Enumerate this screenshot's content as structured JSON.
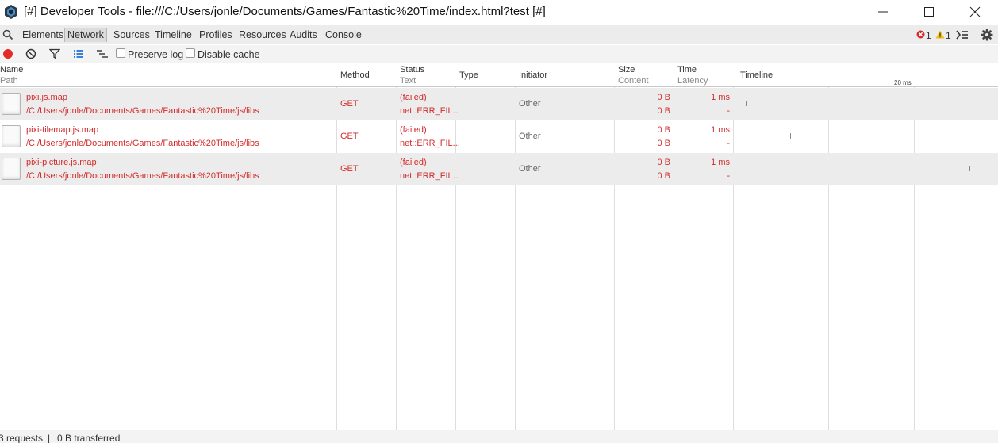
{
  "window": {
    "title": "[#] Developer Tools - file:///C:/Users/jonle/Documents/Games/Fantastic%20Time/index.html?test [#]"
  },
  "tabs": [
    {
      "label": "Elements"
    },
    {
      "label": "Network",
      "active": true
    },
    {
      "label": "Sources"
    },
    {
      "label": "Timeline"
    },
    {
      "label": "Profiles"
    },
    {
      "label": "Resources"
    },
    {
      "label": "Audits"
    },
    {
      "label": "Console"
    }
  ],
  "status_counts": {
    "errors": "1",
    "warnings": "1"
  },
  "toolbar": {
    "preserve_log": "Preserve log",
    "disable_cache": "Disable cache",
    "record_color": "#e22b2b"
  },
  "columns": {
    "name": "Name",
    "path": "Path",
    "method": "Method",
    "status": "Status",
    "text": "Text",
    "type": "Type",
    "initiator": "Initiator",
    "size": "Size",
    "content": "Content",
    "time": "Time",
    "latency": "Latency",
    "timeline": "Timeline",
    "tick_20": "20 ms"
  },
  "requests": [
    {
      "name": "pixi.js.map",
      "path": "/C:/Users/jonle/Documents/Games/Fantastic%20Time/js/libs",
      "method": "GET",
      "status": "(failed)",
      "status_text": "net::ERR_FIL...",
      "type": "",
      "initiator": "Other",
      "size": "0 B",
      "content": "0 B",
      "time": "1 ms",
      "latency": "-"
    },
    {
      "name": "pixi-tilemap.js.map",
      "path": "/C:/Users/jonle/Documents/Games/Fantastic%20Time/js/libs",
      "method": "GET",
      "status": "(failed)",
      "status_text": "net::ERR_FIL...",
      "type": "",
      "initiator": "Other",
      "size": "0 B",
      "content": "0 B",
      "time": "1 ms",
      "latency": "-"
    },
    {
      "name": "pixi-picture.js.map",
      "path": "/C:/Users/jonle/Documents/Games/Fantastic%20Time/js/libs",
      "method": "GET",
      "status": "(failed)",
      "status_text": "net::ERR_FIL...",
      "type": "",
      "initiator": "Other",
      "size": "0 B",
      "content": "0 B",
      "time": "1 ms",
      "latency": "-"
    }
  ],
  "statusbar": {
    "requests": "3 requests",
    "separator": "|",
    "transferred": "0 B transferred"
  },
  "colors": {
    "error_red": "#d32c2c",
    "warning_yellow": "#f4c20d"
  }
}
